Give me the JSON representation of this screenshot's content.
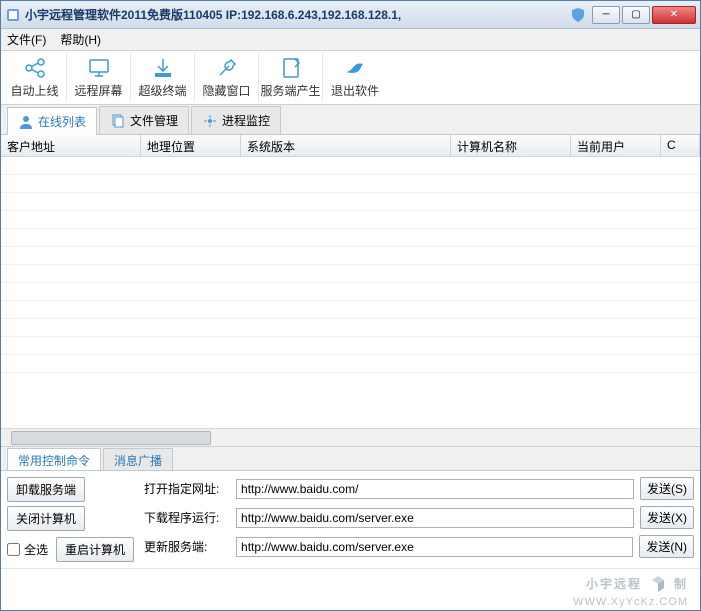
{
  "title": "小宇远程管理软件2011免费版110405  IP:192.168.6.243,192.168.128.1,",
  "menubar": {
    "file": "文件(F)",
    "help": "帮助(H)"
  },
  "toolbar": [
    {
      "name": "auto-online",
      "label": "自动上线",
      "icon": "share-icon"
    },
    {
      "name": "remote-screen",
      "label": "远程屏幕",
      "icon": "monitor-icon"
    },
    {
      "name": "super-terminal",
      "label": "超级终端",
      "icon": "download-icon"
    },
    {
      "name": "hide-window",
      "label": "隐藏窗口",
      "icon": "wrench-icon"
    },
    {
      "name": "server-generate",
      "label": "服务端产生",
      "icon": "note-icon"
    },
    {
      "name": "exit-software",
      "label": "退出软件",
      "icon": "bird-icon"
    }
  ],
  "tabs": {
    "online_list": "在线列表",
    "file_manage": "文件管理",
    "process_monitor": "进程监控"
  },
  "columns": {
    "client_addr": "客户地址",
    "geo": "地理位置",
    "sys_ver": "系统版本",
    "computer_name": "计算机名称",
    "current_user": "当前用户",
    "c": "C"
  },
  "bottom_tabs": {
    "common_cmd": "常用控制命令",
    "broadcast": "消息广播"
  },
  "cmd_buttons": {
    "uninstall": "卸载服务端",
    "shutdown": "关闭计算机",
    "restart": "重启计算机",
    "select_all": "全选"
  },
  "cmd_rows": {
    "open_url_label": "打开指定网址:",
    "open_url_value": "http://www.baidu.com/",
    "download_run_label": "下载程序运行:",
    "download_run_value": "http://www.baidu.com/server.exe",
    "update_server_label": "更新服务端:",
    "update_server_value": "http://www.baidu.com/server.exe",
    "send_s": "发送(S)",
    "send_x": "发送(X)",
    "send_n": "发送(N)"
  },
  "footer": {
    "brand": "小宇远程",
    "brand_tail": "制",
    "url": "WWW.XyYcKz.COM"
  }
}
